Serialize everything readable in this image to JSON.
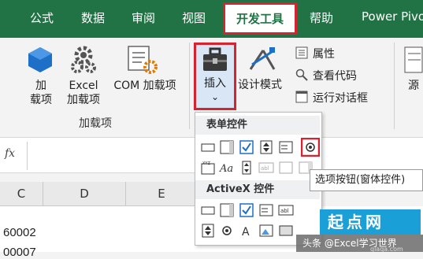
{
  "tabs": [
    "公式",
    "数据",
    "审阅",
    "视图",
    "开发工具",
    "帮助",
    "Power Pivo"
  ],
  "ribbon": {
    "addins_btn_line1": "加",
    "addins_btn_line2": "载项",
    "excel_addins_line1": "Excel",
    "excel_addins_line2": "加载项",
    "com_addins": "COM 加载项",
    "addins_group": "加载项",
    "insert": "插入",
    "insert_chevron": "⌄",
    "design_mode": "设计模式",
    "properties": "属性",
    "view_code": "查看代码",
    "run_dialog": "运行对话框",
    "source": "源"
  },
  "formula_bar": {
    "fx": "fx"
  },
  "columns": [
    "C",
    "D",
    "E"
  ],
  "cells": [
    "60002",
    "00007"
  ],
  "dropdown": {
    "form_controls_title": "表单控件",
    "activex_title": "ActiveX 控件"
  },
  "tooltip": "选项按钮(窗体控件)",
  "watermark": {
    "logo_text": "起点网",
    "credit": "头条 @Excel学习世界",
    "url": "qiaqa.com"
  },
  "colors": {
    "excel_green": "#217346",
    "highlight_red": "#d6232f"
  }
}
